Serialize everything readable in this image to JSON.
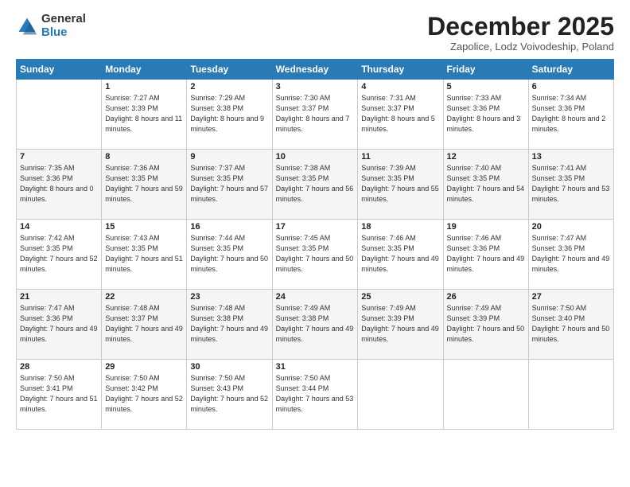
{
  "logo": {
    "general": "General",
    "blue": "Blue"
  },
  "header": {
    "title": "December 2025",
    "subtitle": "Zapolice, Lodz Voivodeship, Poland"
  },
  "weekdays": [
    "Sunday",
    "Monday",
    "Tuesday",
    "Wednesday",
    "Thursday",
    "Friday",
    "Saturday"
  ],
  "weeks": [
    [
      {
        "day": "",
        "sunrise": "",
        "sunset": "",
        "daylight": ""
      },
      {
        "day": "1",
        "sunrise": "Sunrise: 7:27 AM",
        "sunset": "Sunset: 3:39 PM",
        "daylight": "Daylight: 8 hours and 11 minutes."
      },
      {
        "day": "2",
        "sunrise": "Sunrise: 7:29 AM",
        "sunset": "Sunset: 3:38 PM",
        "daylight": "Daylight: 8 hours and 9 minutes."
      },
      {
        "day": "3",
        "sunrise": "Sunrise: 7:30 AM",
        "sunset": "Sunset: 3:37 PM",
        "daylight": "Daylight: 8 hours and 7 minutes."
      },
      {
        "day": "4",
        "sunrise": "Sunrise: 7:31 AM",
        "sunset": "Sunset: 3:37 PM",
        "daylight": "Daylight: 8 hours and 5 minutes."
      },
      {
        "day": "5",
        "sunrise": "Sunrise: 7:33 AM",
        "sunset": "Sunset: 3:36 PM",
        "daylight": "Daylight: 8 hours and 3 minutes."
      },
      {
        "day": "6",
        "sunrise": "Sunrise: 7:34 AM",
        "sunset": "Sunset: 3:36 PM",
        "daylight": "Daylight: 8 hours and 2 minutes."
      }
    ],
    [
      {
        "day": "7",
        "sunrise": "Sunrise: 7:35 AM",
        "sunset": "Sunset: 3:36 PM",
        "daylight": "Daylight: 8 hours and 0 minutes."
      },
      {
        "day": "8",
        "sunrise": "Sunrise: 7:36 AM",
        "sunset": "Sunset: 3:35 PM",
        "daylight": "Daylight: 7 hours and 59 minutes."
      },
      {
        "day": "9",
        "sunrise": "Sunrise: 7:37 AM",
        "sunset": "Sunset: 3:35 PM",
        "daylight": "Daylight: 7 hours and 57 minutes."
      },
      {
        "day": "10",
        "sunrise": "Sunrise: 7:38 AM",
        "sunset": "Sunset: 3:35 PM",
        "daylight": "Daylight: 7 hours and 56 minutes."
      },
      {
        "day": "11",
        "sunrise": "Sunrise: 7:39 AM",
        "sunset": "Sunset: 3:35 PM",
        "daylight": "Daylight: 7 hours and 55 minutes."
      },
      {
        "day": "12",
        "sunrise": "Sunrise: 7:40 AM",
        "sunset": "Sunset: 3:35 PM",
        "daylight": "Daylight: 7 hours and 54 minutes."
      },
      {
        "day": "13",
        "sunrise": "Sunrise: 7:41 AM",
        "sunset": "Sunset: 3:35 PM",
        "daylight": "Daylight: 7 hours and 53 minutes."
      }
    ],
    [
      {
        "day": "14",
        "sunrise": "Sunrise: 7:42 AM",
        "sunset": "Sunset: 3:35 PM",
        "daylight": "Daylight: 7 hours and 52 minutes."
      },
      {
        "day": "15",
        "sunrise": "Sunrise: 7:43 AM",
        "sunset": "Sunset: 3:35 PM",
        "daylight": "Daylight: 7 hours and 51 minutes."
      },
      {
        "day": "16",
        "sunrise": "Sunrise: 7:44 AM",
        "sunset": "Sunset: 3:35 PM",
        "daylight": "Daylight: 7 hours and 50 minutes."
      },
      {
        "day": "17",
        "sunrise": "Sunrise: 7:45 AM",
        "sunset": "Sunset: 3:35 PM",
        "daylight": "Daylight: 7 hours and 50 minutes."
      },
      {
        "day": "18",
        "sunrise": "Sunrise: 7:46 AM",
        "sunset": "Sunset: 3:35 PM",
        "daylight": "Daylight: 7 hours and 49 minutes."
      },
      {
        "day": "19",
        "sunrise": "Sunrise: 7:46 AM",
        "sunset": "Sunset: 3:36 PM",
        "daylight": "Daylight: 7 hours and 49 minutes."
      },
      {
        "day": "20",
        "sunrise": "Sunrise: 7:47 AM",
        "sunset": "Sunset: 3:36 PM",
        "daylight": "Daylight: 7 hours and 49 minutes."
      }
    ],
    [
      {
        "day": "21",
        "sunrise": "Sunrise: 7:47 AM",
        "sunset": "Sunset: 3:36 PM",
        "daylight": "Daylight: 7 hours and 49 minutes."
      },
      {
        "day": "22",
        "sunrise": "Sunrise: 7:48 AM",
        "sunset": "Sunset: 3:37 PM",
        "daylight": "Daylight: 7 hours and 49 minutes."
      },
      {
        "day": "23",
        "sunrise": "Sunrise: 7:48 AM",
        "sunset": "Sunset: 3:38 PM",
        "daylight": "Daylight: 7 hours and 49 minutes."
      },
      {
        "day": "24",
        "sunrise": "Sunrise: 7:49 AM",
        "sunset": "Sunset: 3:38 PM",
        "daylight": "Daylight: 7 hours and 49 minutes."
      },
      {
        "day": "25",
        "sunrise": "Sunrise: 7:49 AM",
        "sunset": "Sunset: 3:39 PM",
        "daylight": "Daylight: 7 hours and 49 minutes."
      },
      {
        "day": "26",
        "sunrise": "Sunrise: 7:49 AM",
        "sunset": "Sunset: 3:39 PM",
        "daylight": "Daylight: 7 hours and 50 minutes."
      },
      {
        "day": "27",
        "sunrise": "Sunrise: 7:50 AM",
        "sunset": "Sunset: 3:40 PM",
        "daylight": "Daylight: 7 hours and 50 minutes."
      }
    ],
    [
      {
        "day": "28",
        "sunrise": "Sunrise: 7:50 AM",
        "sunset": "Sunset: 3:41 PM",
        "daylight": "Daylight: 7 hours and 51 minutes."
      },
      {
        "day": "29",
        "sunrise": "Sunrise: 7:50 AM",
        "sunset": "Sunset: 3:42 PM",
        "daylight": "Daylight: 7 hours and 52 minutes."
      },
      {
        "day": "30",
        "sunrise": "Sunrise: 7:50 AM",
        "sunset": "Sunset: 3:43 PM",
        "daylight": "Daylight: 7 hours and 52 minutes."
      },
      {
        "day": "31",
        "sunrise": "Sunrise: 7:50 AM",
        "sunset": "Sunset: 3:44 PM",
        "daylight": "Daylight: 7 hours and 53 minutes."
      },
      {
        "day": "",
        "sunrise": "",
        "sunset": "",
        "daylight": ""
      },
      {
        "day": "",
        "sunrise": "",
        "sunset": "",
        "daylight": ""
      },
      {
        "day": "",
        "sunrise": "",
        "sunset": "",
        "daylight": ""
      }
    ]
  ]
}
